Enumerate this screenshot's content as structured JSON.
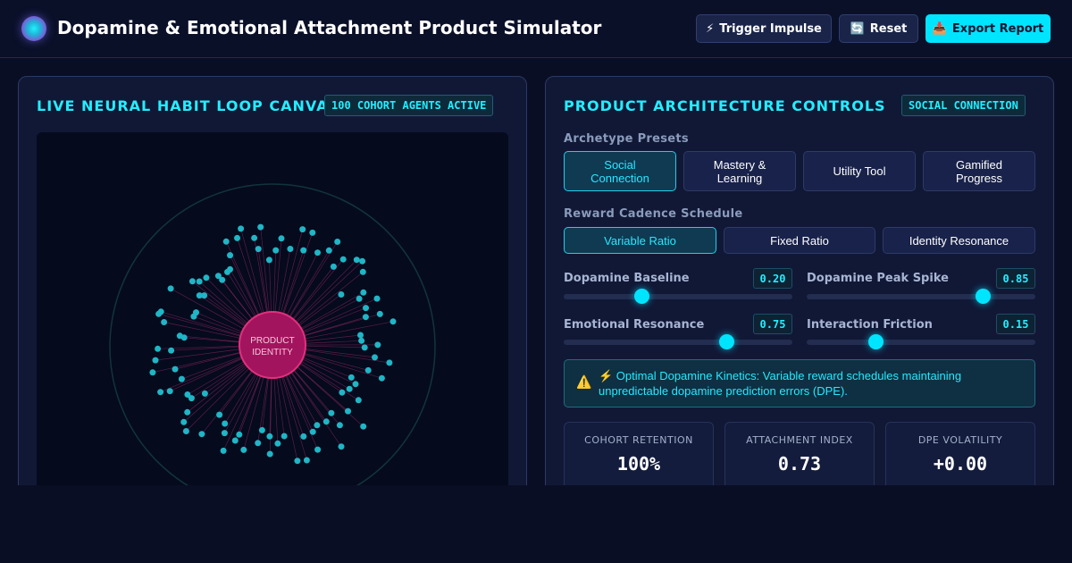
{
  "app": {
    "title": "Dopamine & Emotional Attachment Product Simulator"
  },
  "toolbar": {
    "trigger_icon": "⚡",
    "trigger_label": "Trigger Impulse",
    "reset_icon": "🔄",
    "reset_label": "Reset",
    "export_icon": "📥",
    "export_label": "Export Report"
  },
  "canvas_panel": {
    "title": "LIVE NEURAL HABIT LOOP CANVAS",
    "badge": "100 COHORT AGENTS ACTIVE",
    "center_label_line1": "PRODUCT",
    "center_label_line2": "IDENTITY",
    "agent_count": 100
  },
  "controls_panel": {
    "title": "PRODUCT ARCHITECTURE CONTROLS",
    "badge": "SOCIAL CONNECTION",
    "archetype_label": "Archetype Presets",
    "archetypes": [
      {
        "line1": "Social",
        "line2": "Connection",
        "active": true
      },
      {
        "line1": "Mastery &",
        "line2": "Learning",
        "active": false
      },
      {
        "line1": "Utility Tool",
        "line2": "",
        "active": false
      },
      {
        "line1": "Gamified",
        "line2": "Progress",
        "active": false
      }
    ],
    "cadence_label": "Reward Cadence Schedule",
    "cadences": [
      {
        "label": "Variable Ratio",
        "active": true
      },
      {
        "label": "Fixed Ratio",
        "active": false
      },
      {
        "label": "Identity Resonance",
        "active": false
      }
    ],
    "sliders": {
      "dopamine_baseline": {
        "label": "Dopamine Baseline",
        "value": "0.20",
        "fraction": 0.34
      },
      "dopamine_peak": {
        "label": "Dopamine Peak Spike",
        "value": "0.85",
        "fraction": 0.77
      },
      "emotional_resonance": {
        "label": "Emotional Resonance",
        "value": "0.75",
        "fraction": 0.71
      },
      "interaction_friction": {
        "label": "Interaction Friction",
        "value": "0.15",
        "fraction": 0.3
      }
    },
    "alert": {
      "icon": "⚠️",
      "text": "⚡ Optimal Dopamine Kinetics: Variable reward schedules maintaining unpredictable dopamine prediction errors (DPE)."
    },
    "stats": [
      {
        "label": "COHORT RETENTION",
        "value": "100%"
      },
      {
        "label": "ATTACHMENT INDEX",
        "value": "0.73"
      },
      {
        "label": "DPE VOLATILITY",
        "value": "+0.00"
      }
    ]
  },
  "colors": {
    "accent": "#00e5ff",
    "node": "#1fb6c6",
    "core": "#c0327a",
    "link": "#c0327a"
  }
}
